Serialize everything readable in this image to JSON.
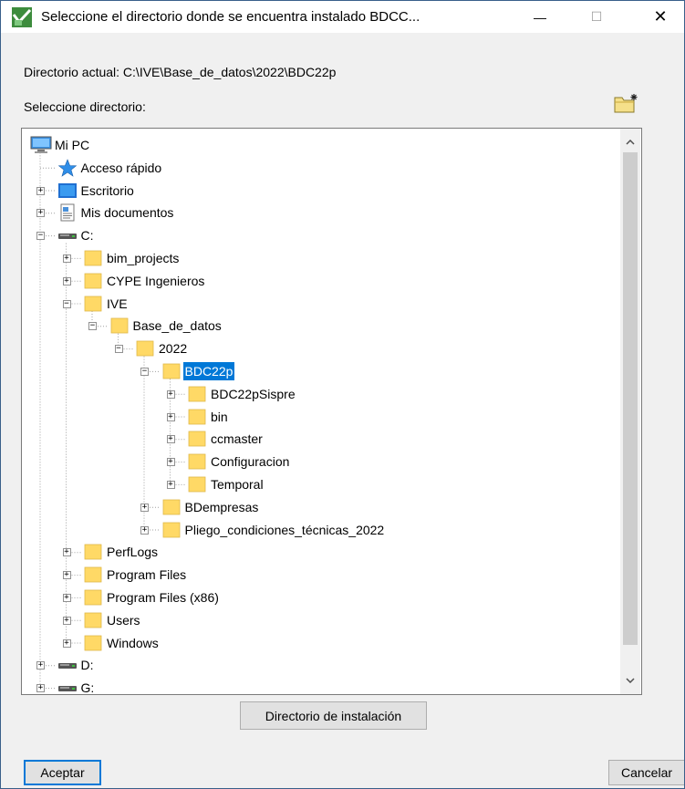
{
  "window": {
    "title": "Seleccione el directorio donde se encuentra instalado BDCC...",
    "minimize_glyph": "—",
    "maximize_glyph": "☐",
    "close_glyph": "✕"
  },
  "current_directory": {
    "text": "Directorio actual:  C:\\IVE\\Base_de_datos\\2022\\BDC22p"
  },
  "select_label": "Seleccione directorio:",
  "tree": {
    "nodes": [
      {
        "label": "Mi PC",
        "icon": "computer-icon"
      },
      {
        "label": "Acceso rápido",
        "icon": "star-icon"
      },
      {
        "label": "Escritorio",
        "icon": "desktop-icon"
      },
      {
        "label": "Mis documentos",
        "icon": "documents-icon"
      },
      {
        "label": "C:",
        "icon": "drive-icon"
      },
      {
        "label": "bim_projects",
        "icon": "folder-icon"
      },
      {
        "label": "CYPE Ingenieros",
        "icon": "folder-icon"
      },
      {
        "label": "IVE",
        "icon": "folder-icon"
      },
      {
        "label": "Base_de_datos",
        "icon": "folder-icon"
      },
      {
        "label": "2022",
        "icon": "folder-icon"
      },
      {
        "label": "BDC22p",
        "icon": "folder-icon"
      },
      {
        "label": "BDC22pSispre",
        "icon": "folder-icon"
      },
      {
        "label": "bin",
        "icon": "folder-icon"
      },
      {
        "label": "ccmaster",
        "icon": "folder-icon"
      },
      {
        "label": "Configuracion",
        "icon": "folder-icon"
      },
      {
        "label": "Temporal",
        "icon": "folder-icon"
      },
      {
        "label": "BDempresas",
        "icon": "folder-icon"
      },
      {
        "label": "Pliego_condiciones_técnicas_2022",
        "icon": "folder-icon"
      },
      {
        "label": "PerfLogs",
        "icon": "folder-icon"
      },
      {
        "label": "Program Files",
        "icon": "folder-icon"
      },
      {
        "label": "Program Files (x86)",
        "icon": "folder-icon"
      },
      {
        "label": "Users",
        "icon": "folder-icon"
      },
      {
        "label": "Windows",
        "icon": "folder-icon"
      },
      {
        "label": "D:",
        "icon": "drive-icon"
      },
      {
        "label": "G:",
        "icon": "drive-icon"
      }
    ],
    "selected": "BDC22p"
  },
  "buttons": {
    "install_dir": "Directorio de instalación",
    "accept": "Aceptar",
    "cancel": "Cancelar"
  },
  "colors": {
    "selection": "#0078d7",
    "folder": "#ffd966"
  }
}
